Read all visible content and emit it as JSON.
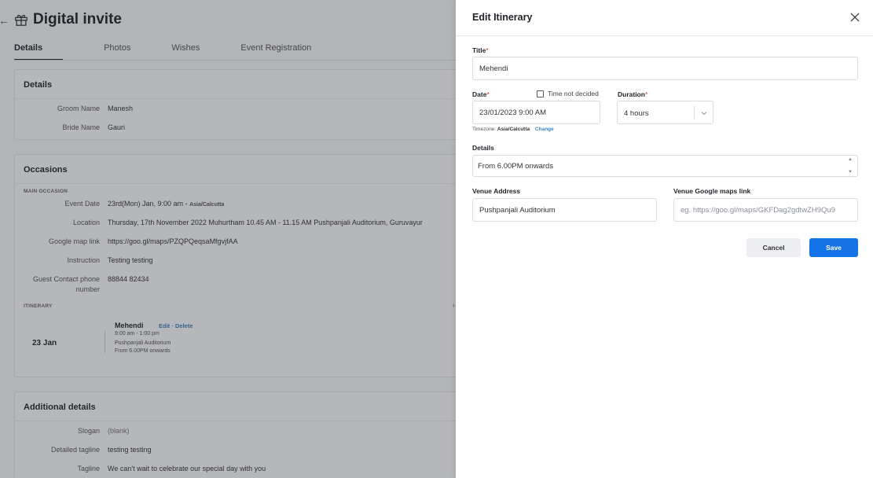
{
  "page": {
    "title": "Digital invite",
    "tabs": [
      {
        "label": "Details",
        "active": true
      },
      {
        "label": "Photos",
        "active": false
      },
      {
        "label": "Wishes",
        "active": false
      },
      {
        "label": "Event Registration",
        "active": false
      }
    ]
  },
  "details_card": {
    "title": "Details",
    "rows": [
      {
        "key": "Groom Name",
        "value": "Manesh"
      },
      {
        "key": "Bride Name",
        "value": "Gauri"
      }
    ]
  },
  "occasions_card": {
    "title": "Occasions",
    "main_caption": "MAIN OCCASION",
    "event_date_key": "Event Date",
    "event_date_value": "23rd(Mon) Jan, 9:00 am -",
    "event_date_tz": "Asia/Calcutta",
    "rows": [
      {
        "key": "Location",
        "value": "Thursday, 17th November 2022 Muhurtham 10.45 AM - 11.15 AM Pushpanjali Auditorium, Guruvayur"
      },
      {
        "key": "Google map link",
        "value": "https://goo.gl/maps/PZQPQeqsaMfgvjfAA"
      },
      {
        "key": "Instruction",
        "value": "Testing testing"
      }
    ],
    "contact_key_line1": "Guest Contact phone",
    "contact_key_line2": "number",
    "contact_value": "88844 82434",
    "itinerary_caption": "ITINERARY",
    "itinerary": {
      "date": "23 Jan",
      "name": "Mehendi",
      "edit": "Edit",
      "sep": "·",
      "delete": "Delete",
      "time": "9:00 am - 1:00 pm",
      "venue": "Pushpanjali Auditorium",
      "details": "From 6.00PM onwards"
    },
    "plus": "+"
  },
  "additional_card": {
    "title": "Additional details",
    "rows": [
      {
        "key": "Slogan",
        "value": "(blank)"
      },
      {
        "key": "Detailed tagline",
        "value": "testing testing"
      },
      {
        "key": "Tagline",
        "value": "We can't wait to celebrate our special day with you"
      }
    ]
  },
  "drawer": {
    "title": "Edit Itinerary",
    "title_label": "Title",
    "title_value": "Mehendi",
    "required_mark": "*",
    "date_label": "Date",
    "date_value": "23/01/2023 9:00 AM",
    "time_not_decided": "Time not decided",
    "duration_label": "Duration",
    "duration_value": "4 hours",
    "timezone_prefix": "Timezone:",
    "timezone_value": "Asia/Calcutta",
    "timezone_change": "Change",
    "details_label": "Details",
    "details_value": "From 6.00PM onwards",
    "venue_label": "Venue Address",
    "venue_value": "Pushpanjali Auditorium",
    "maps_label": "Venue Google maps link",
    "maps_placeholder": "eg. https://goo.gl/maps/GKFDag2gdtwZH9Qu9",
    "cancel_label": "Cancel",
    "save_label": "Save"
  },
  "colors": {
    "primary": "#1473e6",
    "link": "#3b82c4",
    "required": "#d93025"
  }
}
